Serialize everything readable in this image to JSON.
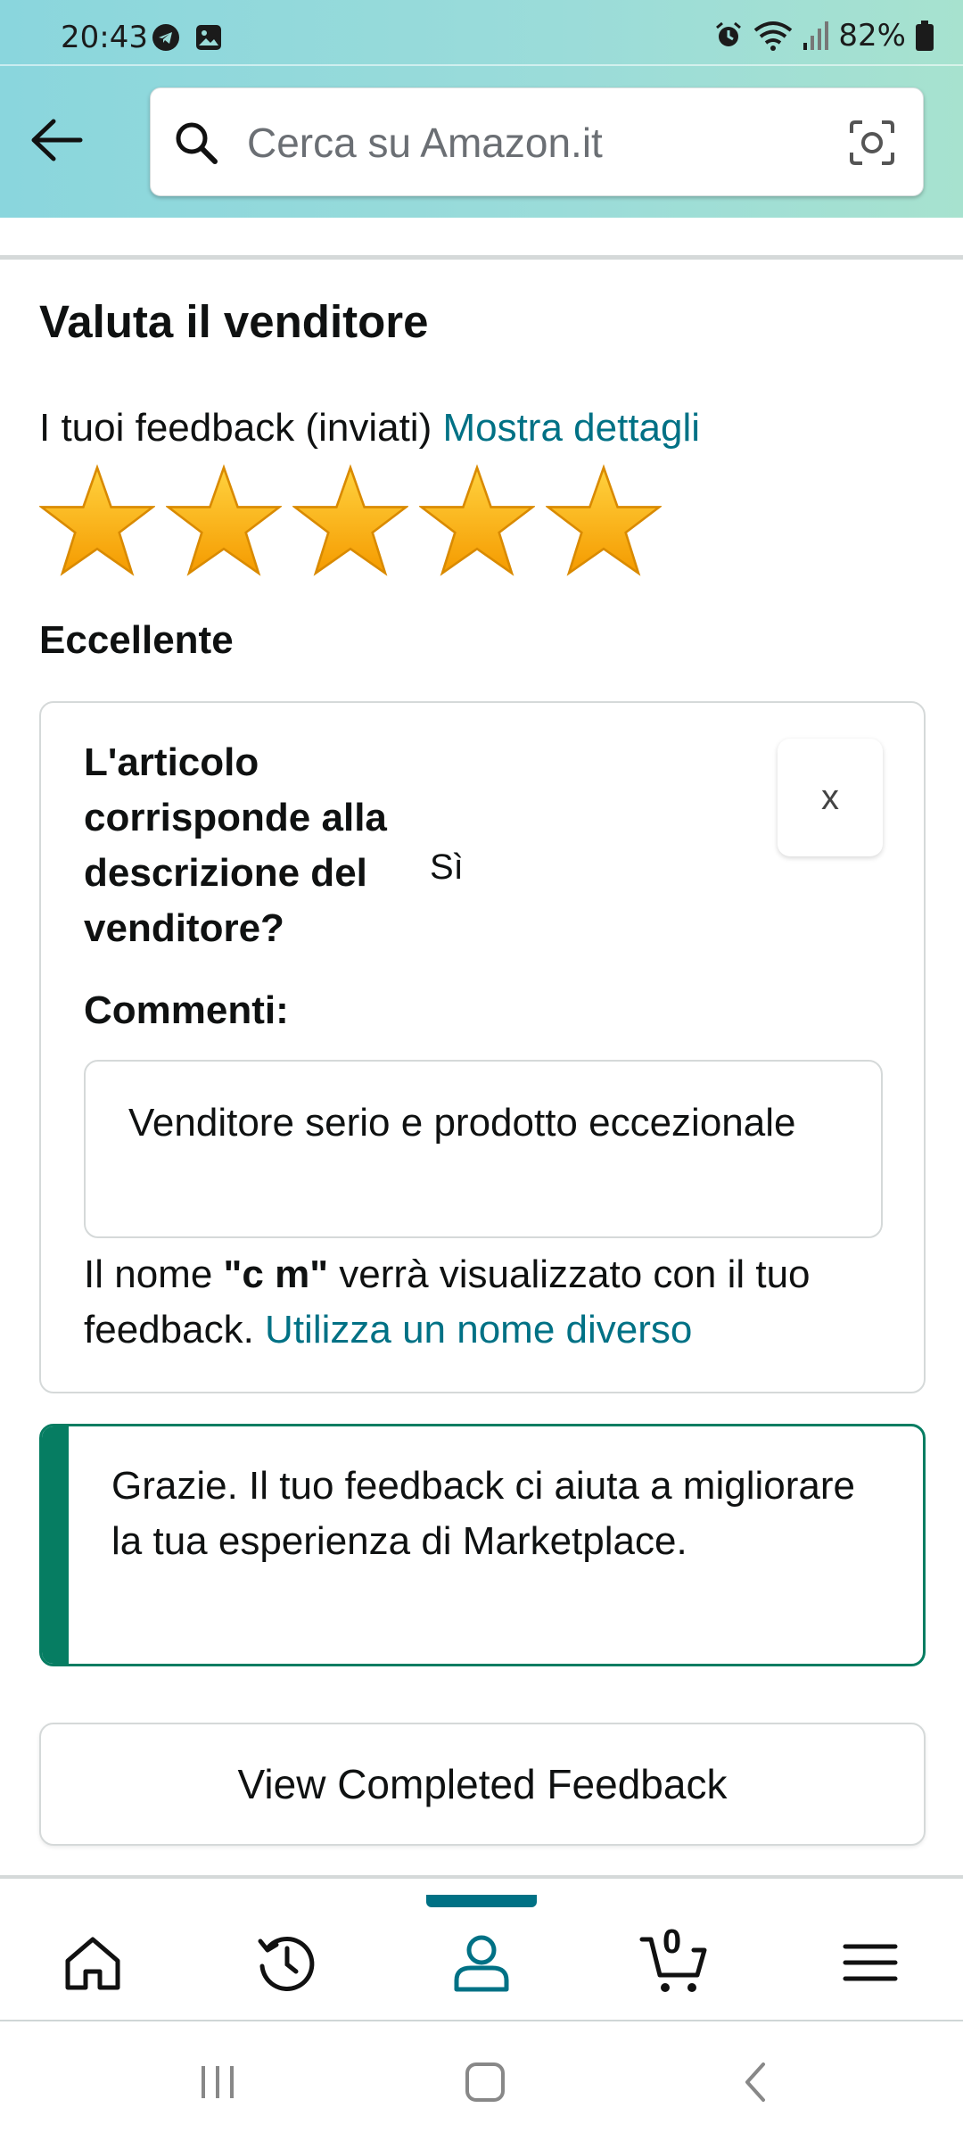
{
  "status_bar": {
    "time": "20:43",
    "battery": "82%",
    "icons": [
      "telegram-icon",
      "gallery-icon",
      "alarm-icon",
      "wifi-icon",
      "signal-icon",
      "battery-icon"
    ]
  },
  "header": {
    "search_placeholder": "Cerca su Amazon.it"
  },
  "main": {
    "title": "Valuta il venditore",
    "feedback_prefix": "I tuoi feedback (inviati)",
    "details_link": "Mostra dettagli",
    "stars": 5,
    "stars_max": 5,
    "rating_word": "Eccellente"
  },
  "review_card": {
    "question": "L'articolo corrisponde alla descrizione del venditore?",
    "answer": "Sì",
    "close_label": "x",
    "comments_label": "Commenti:",
    "comment": "Venditore serio e prodotto eccezionale",
    "name_prefix": "Il nome ",
    "name_value": "\"c m\"",
    "name_suffix": " verrà visualizzato con il tuo feedback.",
    "change_name_link": "Utilizza un nome diverso"
  },
  "thanks": {
    "message": "Grazie. Il tuo feedback ci aiuta a migliorare la tua esperienza di Marketplace."
  },
  "view_button": "View Completed Feedback",
  "bottom_nav": {
    "items": [
      "home-icon",
      "history-icon",
      "account-icon",
      "cart-icon",
      "menu-icon"
    ],
    "active": "account-icon",
    "cart_count": "0"
  },
  "colors": {
    "accent": "#007185",
    "success": "#067d62",
    "star": "#ffa41c"
  }
}
